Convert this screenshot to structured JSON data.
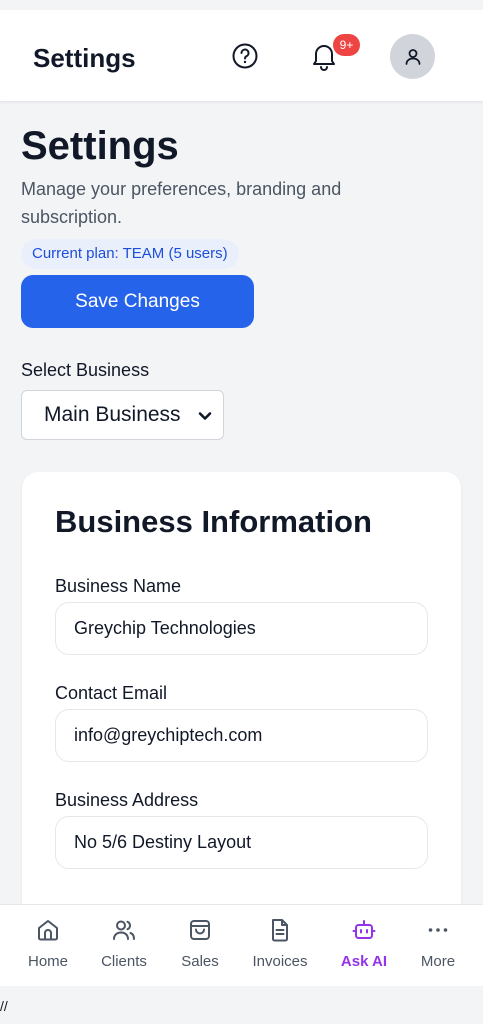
{
  "header": {
    "title": "Settings",
    "notification_count": "9+",
    "icons": [
      "help-icon",
      "bell-icon",
      "user-icon"
    ]
  },
  "page": {
    "title": "Settings",
    "subtitle": "Manage your preferences, branding and subscription.",
    "plan_badge": "Current plan: TEAM (5 users)",
    "save_label": "Save Changes"
  },
  "business_select": {
    "label": "Select Business",
    "value": "Main Business"
  },
  "business_info": {
    "title": "Business Information",
    "fields": [
      {
        "label": "Business Name",
        "value": "Greychip Technologies"
      },
      {
        "label": "Contact Email",
        "value": "info@greychiptech.com"
      },
      {
        "label": "Business Address",
        "value": "No 5/6 Destiny Layout"
      }
    ]
  },
  "bottom_nav": {
    "items": [
      {
        "label": "Home",
        "icon": "home-icon"
      },
      {
        "label": "Clients",
        "icon": "users-icon"
      },
      {
        "label": "Sales",
        "icon": "shopping-bag-icon"
      },
      {
        "label": "Invoices",
        "icon": "document-icon"
      },
      {
        "label": "Ask AI",
        "icon": "bot-icon",
        "active": true
      },
      {
        "label": "More",
        "icon": "more-icon"
      }
    ]
  },
  "footer": {
    "text": "//"
  },
  "colors": {
    "accent": "#2563eb",
    "active_nav": "#9333ea",
    "badge": "#ef4444",
    "plan_badge_bg": "#eaf0fb",
    "plan_badge_text": "#1d4ed8"
  }
}
